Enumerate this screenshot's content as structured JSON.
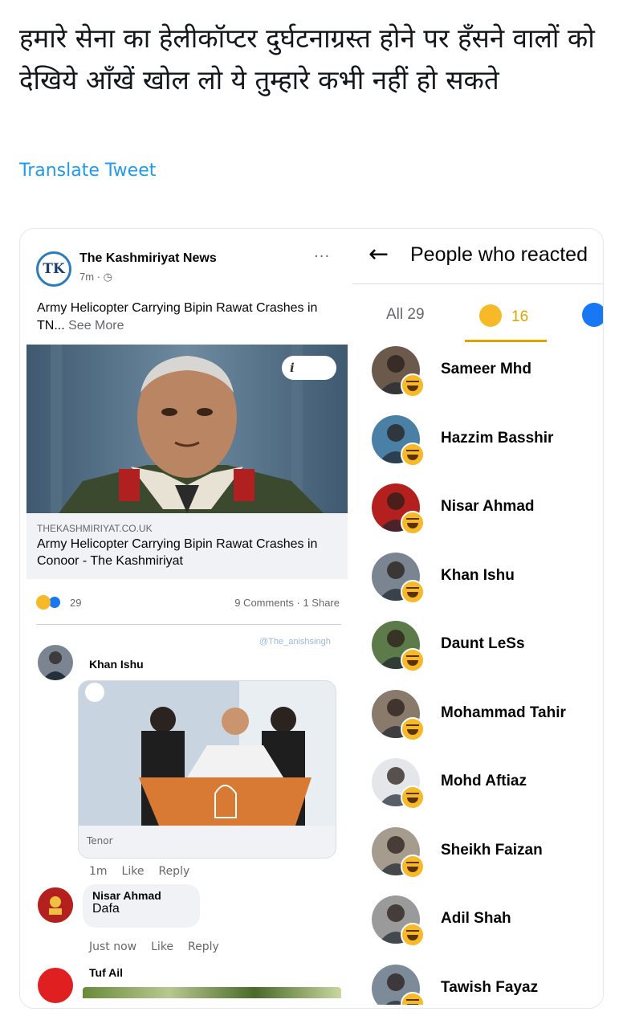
{
  "tweet": {
    "text": "हमारे सेना का हेलीकॉप्टर दुर्घटनाग्रस्त होने पर हँसने वालों को देखिये आँखें खोल लो ये तुम्हारे कभी नहीं हो सकते",
    "translate_label": "Translate Tweet"
  },
  "post": {
    "page_logo_text": "TK",
    "page_name": "The Kashmiriyat News",
    "time": "7m · ◷",
    "more": "···",
    "text": "Army Helicopter Carrying Bipin Rawat Crashes in TN...",
    "see_more": "See More",
    "info_label": "i",
    "link_domain": "THEKASHMIRIYAT.CO.UK",
    "link_title": "Army Helicopter Carrying Bipin Rawat Crashes in Conoor - The Kashmiriyat",
    "reaction_count": "29",
    "comments_shares": "9 Comments · 1 Share",
    "watermark": "@The_anishsingh"
  },
  "comments": [
    {
      "name": "Khan Ishu",
      "gif_source": "Tenor",
      "time": "1m",
      "like": "Like",
      "reply": "Reply"
    },
    {
      "name": "Nisar Ahmad",
      "text": "Dafa",
      "time": "Just now",
      "like": "Like",
      "reply": "Reply"
    },
    {
      "name": "Tuf Ail"
    }
  ],
  "reactions_panel": {
    "back": "←",
    "title": "People who reacted",
    "tabs": {
      "all": "All 29",
      "haha_count": "16"
    },
    "people": [
      {
        "name": "Sameer Mhd",
        "avatar_color": "#6b5a4c"
      },
      {
        "name": "Hazzim Basshir",
        "avatar_color": "#4a7fa6"
      },
      {
        "name": "Nisar Ahmad",
        "avatar_color": "#b3201e"
      },
      {
        "name": "Khan Ishu",
        "avatar_color": "#7a8591"
      },
      {
        "name": "Daunt LeSs",
        "avatar_color": "#5c7a4a"
      },
      {
        "name": "Mohammad Tahir",
        "avatar_color": "#8a7a6c"
      },
      {
        "name": "Mohd Aftiaz",
        "avatar_color": "#e4e6ea"
      },
      {
        "name": "Sheikh Faizan",
        "avatar_color": "#a69c8e"
      },
      {
        "name": "Adil Shah",
        "avatar_color": "#9a9a9a"
      },
      {
        "name": "Tawish Fayaz",
        "avatar_color": "#7c8a9a"
      }
    ]
  },
  "colors": {
    "translate_link": "#1d9bf0",
    "haha": "#f7b928",
    "like": "#1877f2"
  }
}
